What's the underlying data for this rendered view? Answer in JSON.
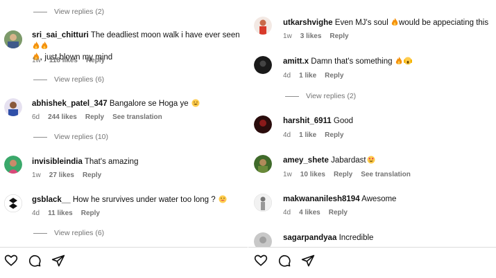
{
  "left": {
    "top_view_replies": "View replies (2)",
    "comments": [
      {
        "user": "sri_sai_chitturi",
        "text_a": "The deadliest moon walk i have ever seen",
        "text_b": ", just blown my mind",
        "time": "1w",
        "likes": "118 likes",
        "reply": "Reply",
        "replies": "View replies (6)"
      },
      {
        "user": "abhishek_patel_347",
        "text": "Bangalore se Hoga ye",
        "time": "6d",
        "likes": "244 likes",
        "reply": "Reply",
        "translate": "See translation",
        "replies": "View replies (10)"
      },
      {
        "user": "invisibleindia",
        "text": "That's amazing",
        "time": "1w",
        "likes": "27 likes",
        "reply": "Reply"
      },
      {
        "user": "gsblack__",
        "text": "How he srurvives under water too long ?",
        "time": "4d",
        "likes": "11 likes",
        "reply": "Reply",
        "replies": "View replies (6)"
      }
    ]
  },
  "right": {
    "comments": [
      {
        "user": "utkarshvighe",
        "text": "Even MJ's soul",
        "text_b": "would be appeciating this",
        "time": "1w",
        "likes": "3 likes",
        "reply": "Reply"
      },
      {
        "user": "amitt.x",
        "text": "Damn that's something",
        "time": "4d",
        "likes": "1 like",
        "reply": "Reply",
        "replies": "View replies (2)"
      },
      {
        "user": "harshit_6911",
        "text": "Good",
        "time": "4d",
        "likes": "1 like",
        "reply": "Reply"
      },
      {
        "user": "amey_shete",
        "text": "Jabardast",
        "time": "1w",
        "likes": "10 likes",
        "reply": "Reply",
        "translate": "See translation"
      },
      {
        "user": "makwananilesh8194",
        "text": "Awesome",
        "time": "4d",
        "likes": "4 likes",
        "reply": "Reply"
      },
      {
        "user": "sagarpandyaa",
        "text": "Incredible"
      }
    ]
  },
  "icons": [
    "heart-icon",
    "comment-icon",
    "share-icon"
  ],
  "colors": {
    "text": "#111111",
    "meta": "#737373",
    "fire": "#f4900c",
    "heart_eyes": "#ffcc4d"
  }
}
